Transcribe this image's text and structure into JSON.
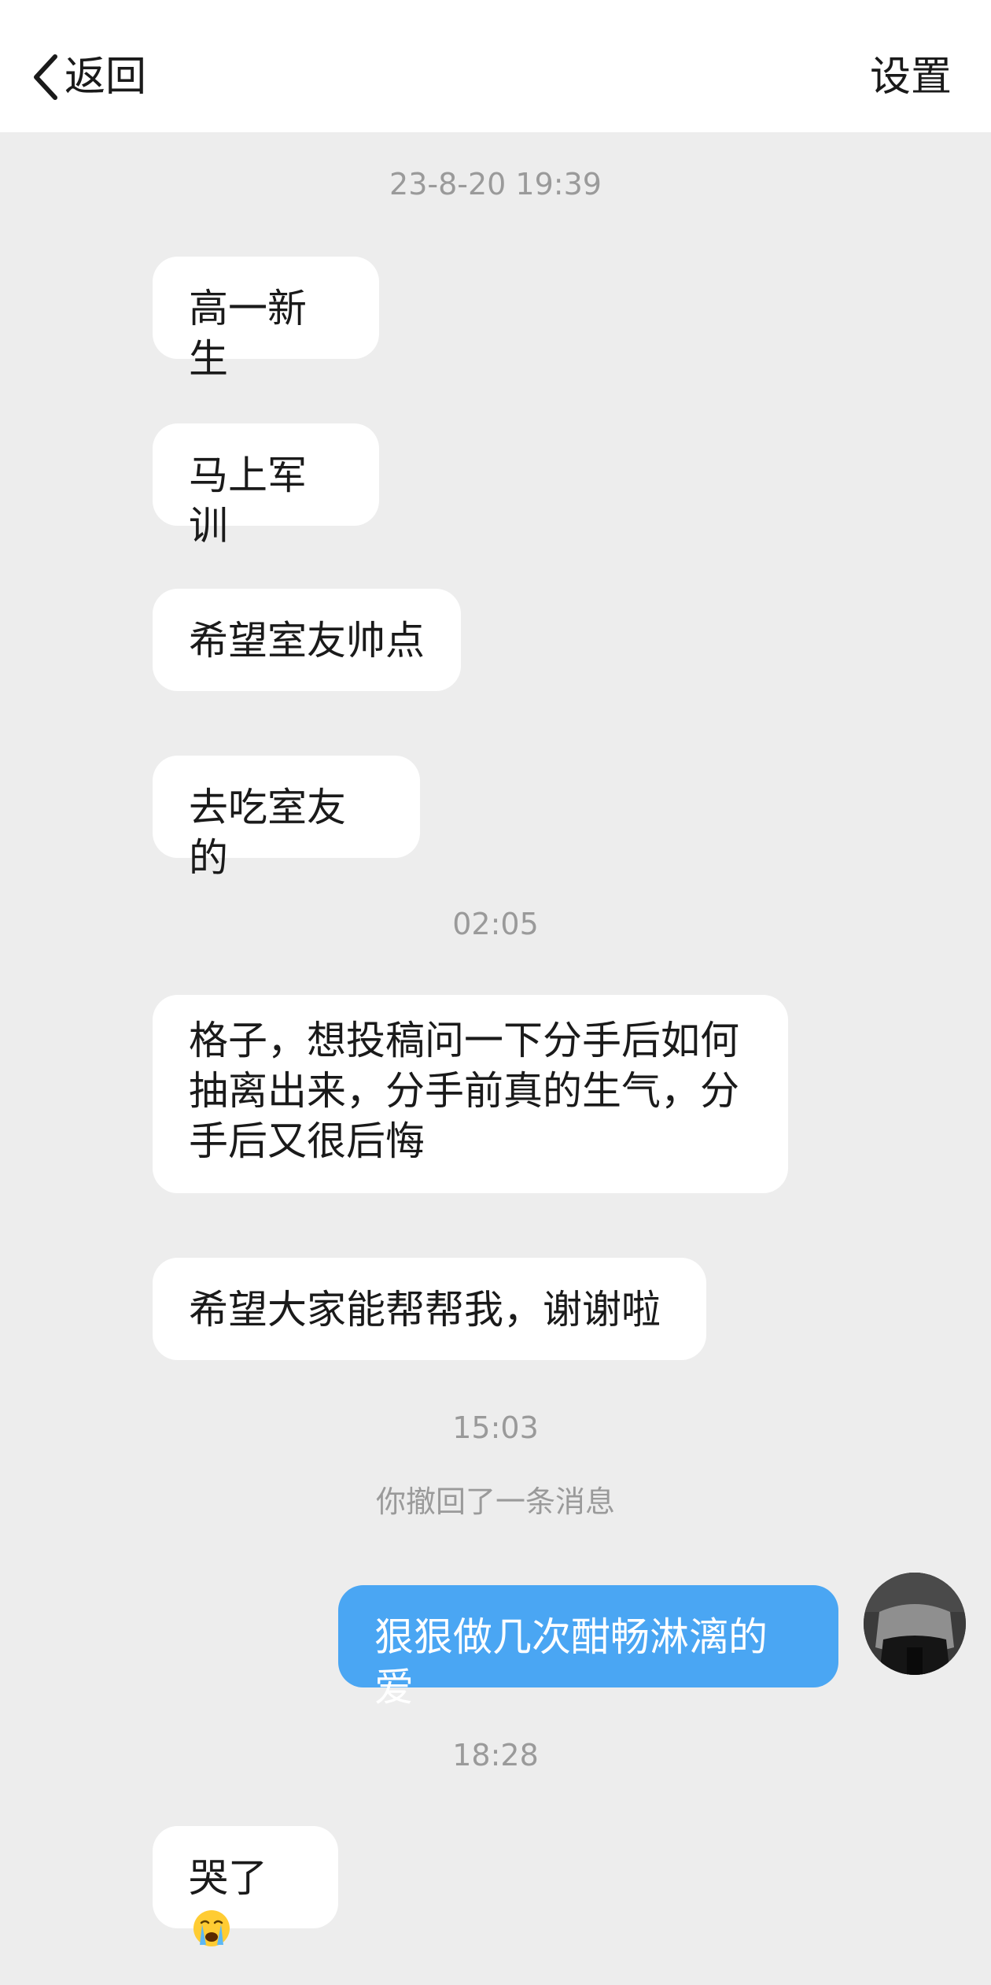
{
  "header": {
    "back_label": "返回",
    "settings_label": "设置"
  },
  "messages": {
    "ts1": "23-8-20 19:39",
    "m1": "高一新生",
    "m2": "马上军训",
    "m3": "希望室友帅点",
    "m4": "去吃室友的",
    "ts2": "02:05",
    "m5_line1": "格子，想投稿问一下分手后如何",
    "m5_line2": "抽离出来，分手前真的生气，分",
    "m5_line3": "手后又很后悔",
    "m6": "希望大家能帮帮我，谢谢啦",
    "ts3": "15:03",
    "recall_notice": "你撤回了一条消息",
    "m7_out": "狠狠做几次酣畅淋漓的爱",
    "ts4": "18:28",
    "m8": "哭了"
  },
  "icons": {
    "back": "chevron-left-icon",
    "crying_emoji": "crying-face-emoji",
    "avatar": "user-avatar"
  },
  "colors": {
    "background": "#ededed",
    "incoming_bubble": "#ffffff",
    "outgoing_bubble": "#4aa6f3",
    "timestamp": "#9a9a9a"
  }
}
